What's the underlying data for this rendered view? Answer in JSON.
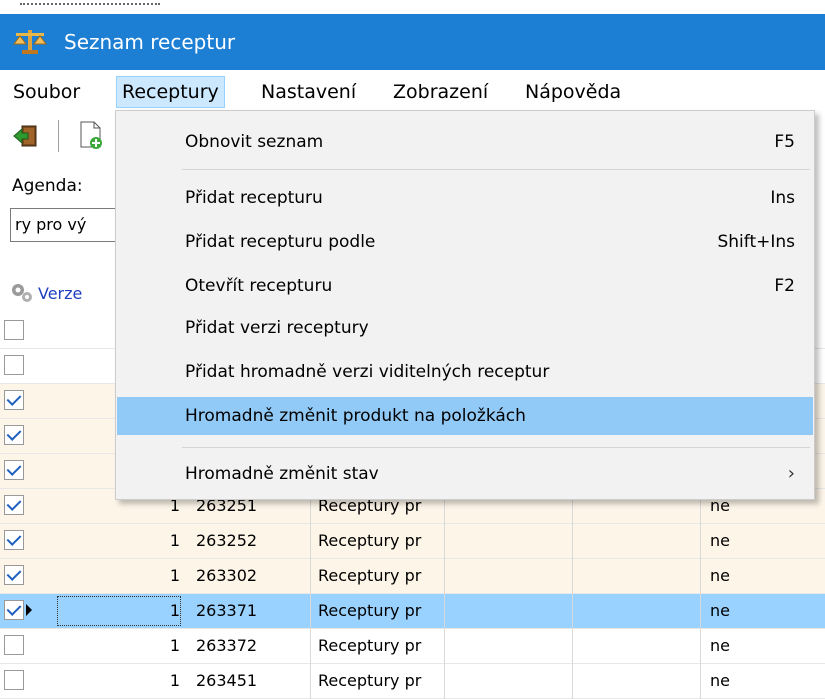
{
  "window": {
    "title": "Seznam receptur"
  },
  "menubar": [
    "Soubor",
    "Receptury",
    "Nastavení",
    "Zobrazení",
    "Nápověda"
  ],
  "toolbar": {
    "buttons": [
      "exit-icon",
      "new-document-icon"
    ]
  },
  "agenda": {
    "label": "Agenda:",
    "value": "ry pro vý"
  },
  "grid": {
    "header_visible": "Verze",
    "rows": [
      {
        "checked": false,
        "num": "",
        "code": "",
        "name": "",
        "flag": "",
        "style": "white"
      },
      {
        "checked": false,
        "num": "",
        "code": "",
        "name": "",
        "flag": "",
        "style": "white"
      },
      {
        "checked": true,
        "num": "",
        "code": "",
        "name": "",
        "flag": "",
        "style": "beige"
      },
      {
        "checked": true,
        "num": "",
        "code": "",
        "name": "",
        "flag": "",
        "style": "beige"
      },
      {
        "checked": true,
        "num": "",
        "code": "",
        "name": "",
        "flag": "",
        "style": "beige"
      },
      {
        "checked": true,
        "num": "1",
        "code": "263251",
        "name": "Receptury pr",
        "flag": "ne",
        "style": "beige"
      },
      {
        "checked": true,
        "num": "1",
        "code": "263252",
        "name": "Receptury pr",
        "flag": "ne",
        "style": "beige"
      },
      {
        "checked": true,
        "num": "1",
        "code": "263302",
        "name": "Receptury pr",
        "flag": "ne",
        "style": "beige"
      },
      {
        "checked": true,
        "num": "1",
        "code": "263371",
        "name": "Receptury pr",
        "flag": "ne",
        "style": "sel"
      },
      {
        "checked": false,
        "num": "1",
        "code": "263372",
        "name": "Receptury pr",
        "flag": "ne",
        "style": "white"
      },
      {
        "checked": false,
        "num": "1",
        "code": "263451",
        "name": "Receptury pr",
        "flag": "ne",
        "style": "white"
      }
    ]
  },
  "dropdown": {
    "items": [
      {
        "label": "Obnovit seznam",
        "shortcut": "F5"
      },
      {
        "label": "Přidat recepturu",
        "shortcut": "Ins"
      },
      {
        "label": "Přidat recepturu podle",
        "shortcut": "Shift+Ins"
      },
      {
        "label": "Otevřít recepturu",
        "shortcut": "F2"
      },
      {
        "label": "Přidat verzi receptury",
        "shortcut": ""
      },
      {
        "label": "Přidat hromadně verzi viditelných receptur",
        "shortcut": ""
      },
      {
        "label": "Hromadně změnit produkt na položkách",
        "shortcut": ""
      },
      {
        "label": "Hromadně změnit stav",
        "shortcut": ""
      }
    ]
  },
  "colors": {
    "titlebar": "#1c7fd4",
    "selection": "#99d1ff",
    "menu_highlight": "#91c9f7",
    "beige_row": "#fdf5e8"
  }
}
